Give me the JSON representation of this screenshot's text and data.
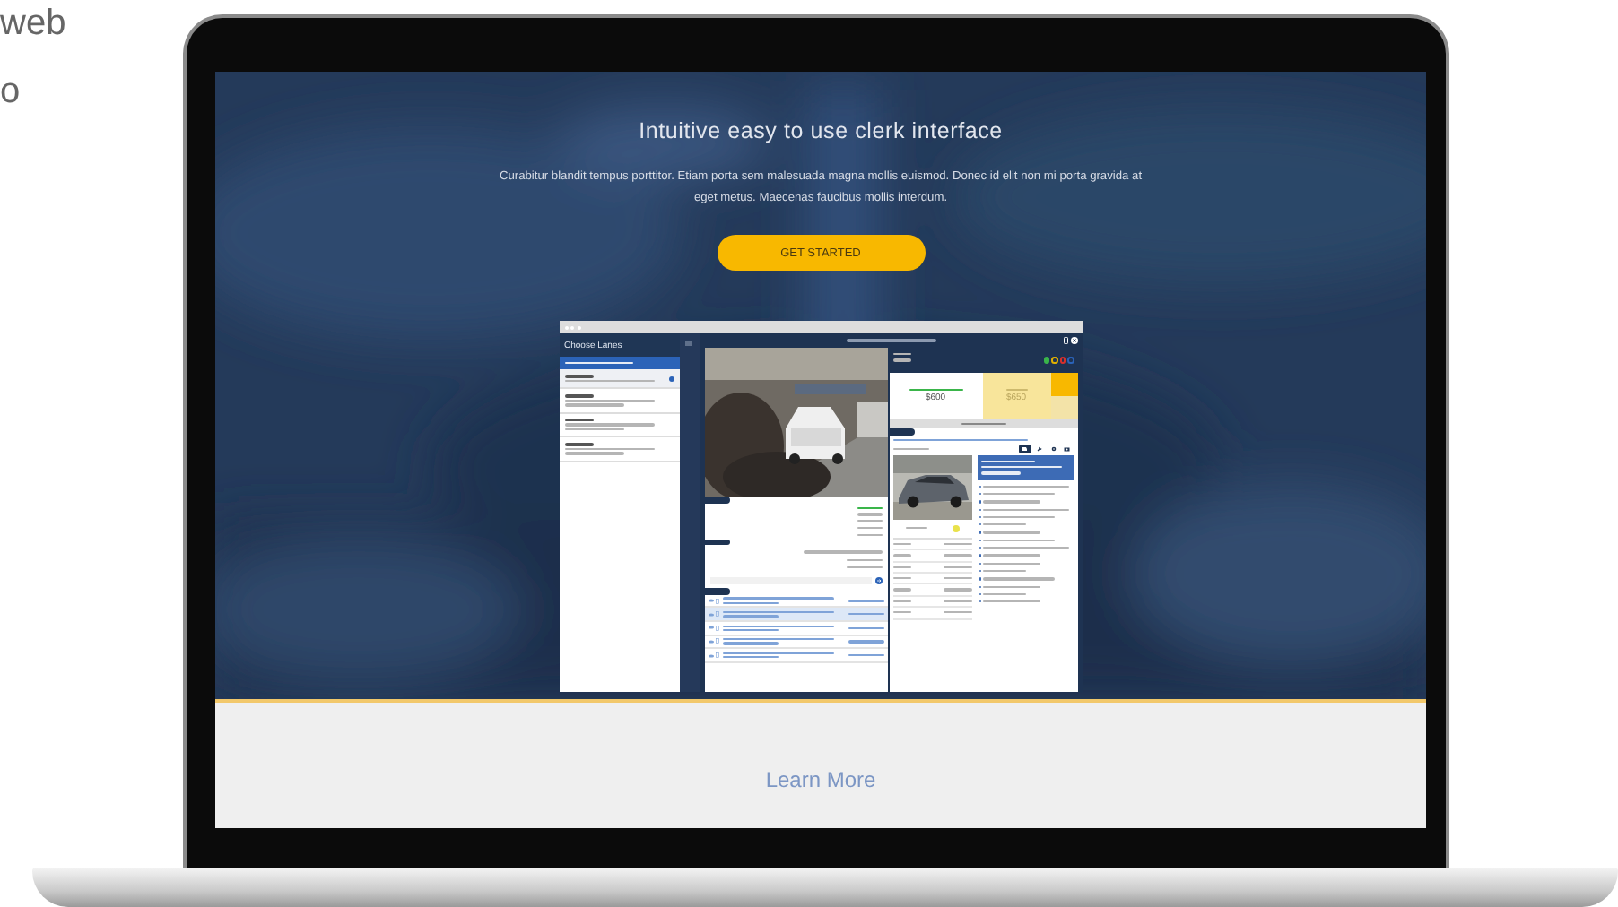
{
  "background_text": [
    "web",
    "o"
  ],
  "hero": {
    "heading": "Intuitive easy to use clerk interface",
    "text": "Curabitur blandit tempus porttitor. Etiam porta sem malesuada magna mollis euismod. Donec id elit non mi porta gravida at eget metus. Maecenas faucibus mollis interdum.",
    "button": "GET STARTED"
  },
  "app": {
    "sidebar_title": "Choose Lanes",
    "lanes": [
      {
        "selected": true
      },
      {
        "selected": false
      },
      {
        "selected": false
      },
      {
        "selected": false
      }
    ],
    "lights": [
      {
        "color": "#3ab54a",
        "on": true
      },
      {
        "color": "#e0b000",
        "on": false
      },
      {
        "color": "#d9302c",
        "on": false
      },
      {
        "color": "#2b63b8",
        "on": false
      }
    ],
    "bid": {
      "high_bid": "$600",
      "asking": "$650",
      "buttons": [
        {
          "selected": true
        },
        {
          "selected": false
        }
      ]
    },
    "history": [
      {
        "leading": true
      },
      {
        "leading": false
      },
      {
        "leading": false
      },
      {
        "leading": false
      },
      {
        "leading": false
      }
    ],
    "vehicle_rows": [
      {
        "selected": false
      },
      {
        "selected": true
      },
      {
        "selected": false
      },
      {
        "selected": false
      },
      {
        "selected": false
      }
    ],
    "tools": [
      {
        "kind": "car",
        "selected": true
      },
      {
        "kind": "wrench",
        "selected": false
      },
      {
        "kind": "gear",
        "selected": false
      },
      {
        "kind": "camera",
        "selected": false
      }
    ]
  },
  "learn_more": "Learn More"
}
